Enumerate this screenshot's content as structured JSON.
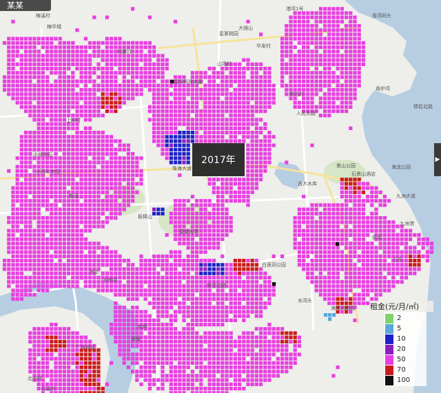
{
  "corner_tab": "某某",
  "year_label": "2017年",
  "legend": {
    "title": "租金(元/月/㎡)",
    "items": [
      {
        "value": "2",
        "color": "#7dd36a"
      },
      {
        "value": "5",
        "color": "#58a8d8"
      },
      {
        "value": "10",
        "color": "#1d22c8"
      },
      {
        "value": "20",
        "color": "#8a1fc0"
      },
      {
        "value": "50",
        "color": "#e83ee0"
      },
      {
        "value": "70",
        "color": "#cc1a1a"
      },
      {
        "value": "100",
        "color": "#111111"
      }
    ]
  },
  "map_labels": [
    "梅溪村",
    "梅华城",
    "星篆桃园",
    "大镜山",
    "港湾1号",
    "香湾码头",
    "华发村",
    "红旗村",
    "山场村",
    "南坑村",
    "国际科技大厦",
    "人民东路",
    "香炉湾",
    "情侣北路",
    "上冲村",
    "中和花园",
    "小西牛老围",
    "新溪",
    "板樟山",
    "吉大水库",
    "景山公园",
    "海滨公园",
    "石景山酒店",
    "暨南大学",
    "白莲洞公园",
    "九洲港",
    "九洲大道",
    "前山",
    "南湾北路",
    "南屏",
    "广珠城轨",
    "北山村",
    "拱北",
    "海湾大酒店",
    "珠海大道",
    "水湾头",
    "石花",
    "香柏路",
    "翠微",
    "石溪村"
  ],
  "colors": {
    "land": "#eeeeea",
    "water": "#b7cde2",
    "road": "#ffffff",
    "road_major": "#f6e39a",
    "green": "#d6e6c6"
  }
}
